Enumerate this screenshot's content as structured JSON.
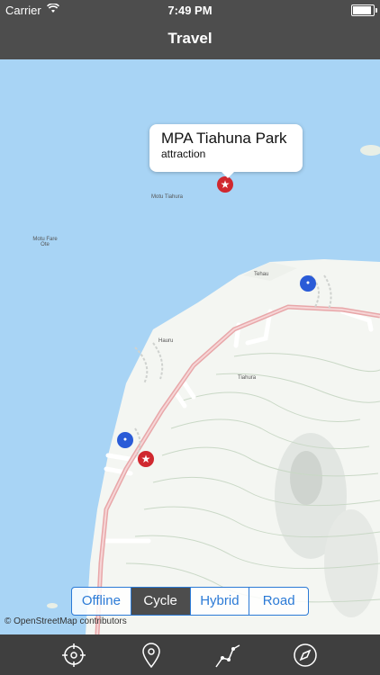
{
  "status": {
    "carrier": "Carrier",
    "time": "7:49 PM",
    "battery_level": 1.0
  },
  "nav": {
    "title": "Travel"
  },
  "map": {
    "labels": {
      "motu_tiahura": "Motu Tiahura",
      "motu_fare_ote": "Motu Fare Ote",
      "tehau": "Tehau",
      "hauru": "Hauru",
      "tiahura": "Tiahura"
    },
    "callout": {
      "name": "MPA Tiahuna Park",
      "type": "attraction"
    },
    "attribution": "© OpenStreetMap contributors"
  },
  "segments": {
    "offline": "Offline",
    "cycle": "Cycle",
    "hybrid": "Hybrid",
    "road": "Road",
    "selected": "Cycle"
  },
  "toolbar": {
    "icons": [
      "locate-icon",
      "pin-icon",
      "route-icon",
      "compass-icon"
    ]
  },
  "colors": {
    "water": "#a8d4f5",
    "land": "#f4f6f2",
    "road": "#e8a7a9",
    "accent": "#2b7ad6",
    "bar": "#4d4d4d"
  }
}
